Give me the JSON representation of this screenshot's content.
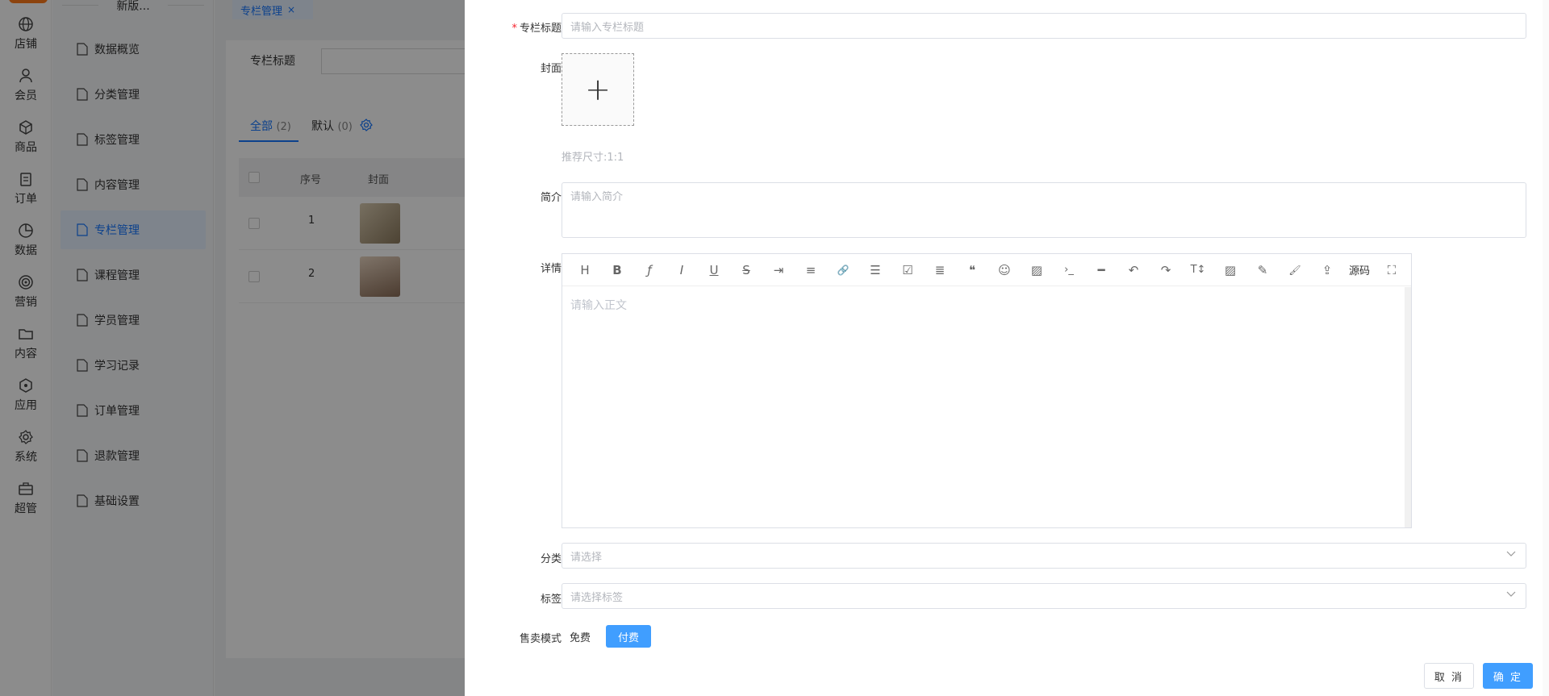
{
  "rail": {
    "items": [
      {
        "label": "店铺",
        "icon": "globe-icon"
      },
      {
        "label": "会员",
        "icon": "user-icon"
      },
      {
        "label": "商品",
        "icon": "box-icon"
      },
      {
        "label": "订单",
        "icon": "clipboard-icon"
      },
      {
        "label": "数据",
        "icon": "pie-chart-icon"
      },
      {
        "label": "营销",
        "icon": "target-icon"
      },
      {
        "label": "内容",
        "icon": "folder-icon"
      },
      {
        "label": "应用",
        "icon": "cube-icon"
      },
      {
        "label": "系统",
        "icon": "gear-icon"
      },
      {
        "label": "超管",
        "icon": "briefcase-icon"
      }
    ]
  },
  "submenu": {
    "title": "新版...",
    "items": [
      {
        "label": "数据概览"
      },
      {
        "label": "分类管理"
      },
      {
        "label": "标签管理"
      },
      {
        "label": "内容管理"
      },
      {
        "label": "专栏管理",
        "active": true
      },
      {
        "label": "课程管理"
      },
      {
        "label": "学员管理"
      },
      {
        "label": "学习记录"
      },
      {
        "label": "订单管理"
      },
      {
        "label": "退款管理"
      },
      {
        "label": "基础设置"
      }
    ]
  },
  "main": {
    "open_tab": "专栏管理",
    "open_tab_close": "×",
    "search_label": "专栏标题",
    "tabs": [
      {
        "label": "全部",
        "count": "(2)"
      },
      {
        "label": "默认",
        "count": "(0)"
      }
    ],
    "columns": [
      "序号",
      "封面"
    ],
    "rows": [
      {
        "num": "1",
        "cover_color": "#b8a88c"
      },
      {
        "num": "2",
        "cover_color": "#c9a888"
      }
    ]
  },
  "drawer": {
    "title_label": "专栏标题",
    "required_mark": "*",
    "title_placeholder": "请输入专栏标题",
    "cover_label": "封面",
    "cover_plus": "+",
    "cover_hint": "推荐尺寸:1:1",
    "intro_label": "简介",
    "intro_placeholder": "请输入简介",
    "detail_label": "详情",
    "editor_placeholder": "请输入正文",
    "toolbar": [
      {
        "name": "heading-icon",
        "glyph": "H"
      },
      {
        "name": "bold-icon",
        "glyph": "B"
      },
      {
        "name": "font-icon",
        "glyph": "ƒ"
      },
      {
        "name": "italic-icon",
        "glyph": "I"
      },
      {
        "name": "underline-icon",
        "glyph": "U"
      },
      {
        "name": "strikethrough-icon",
        "glyph": "S"
      },
      {
        "name": "indent-icon",
        "glyph": "⇥"
      },
      {
        "name": "align-icon",
        "glyph": "≡"
      },
      {
        "name": "link-icon",
        "glyph": "🔗"
      },
      {
        "name": "bullet-list-icon",
        "glyph": "☰"
      },
      {
        "name": "checkbox-icon",
        "glyph": "☑"
      },
      {
        "name": "paragraph-icon",
        "glyph": "≣"
      },
      {
        "name": "quote-icon",
        "glyph": "❝"
      },
      {
        "name": "emoji-icon",
        "glyph": "☺"
      },
      {
        "name": "image-icon",
        "glyph": "▨"
      },
      {
        "name": "code-icon",
        "glyph": "›_"
      },
      {
        "name": "horizontal-rule-icon",
        "glyph": "━"
      },
      {
        "name": "undo-icon",
        "glyph": "↶"
      },
      {
        "name": "redo-icon",
        "glyph": "↷"
      },
      {
        "name": "font-size-icon",
        "glyph": "T↕"
      },
      {
        "name": "insert-image-icon",
        "glyph": "▨"
      },
      {
        "name": "eraser-icon",
        "glyph": "✎"
      },
      {
        "name": "brush-icon",
        "glyph": "🖌"
      },
      {
        "name": "upload-icon",
        "glyph": "⇪"
      }
    ],
    "source_label": "源码",
    "fullscreen_glyph": "⛶",
    "category_label": "分类",
    "category_placeholder": "请选择",
    "tag_label": "标签",
    "tag_placeholder": "请选择标签",
    "sale_mode_label": "售卖模式",
    "sale_free": "免费",
    "sale_paid": "付费",
    "cancel_label": "取 消",
    "confirm_label": "确 定"
  },
  "colors": {
    "accent": "#409eff",
    "active_text": "#1677ff",
    "required": "#f5222d",
    "logo": "#ff7a1a"
  }
}
